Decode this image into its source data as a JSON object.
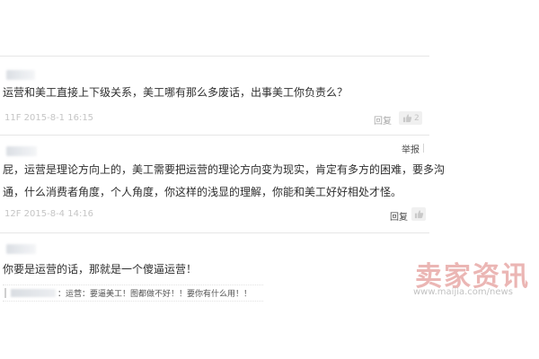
{
  "comments": [
    {
      "text": "运营和美工直接上下级关系，美工哪有那么多废话，出事美工你负责么？",
      "meta": "11F  2015-8-1  16:15",
      "reply_label": "回复",
      "like_count": "2"
    },
    {
      "report_label": "举报",
      "lines": [
        "屁，运营是理论方向上的，美工需要把运营的理论方向变为现实，肯定有多方的困难，要多沟",
        "通，什么消费者角度，个人角度，你这样的浅显的理解，你能和美工好好相处才怪。"
      ],
      "meta": "12F  2015-8-4  14:16",
      "reply_label": "回复"
    },
    {
      "text": "你要是运营的话，那就是一个傻逼运营！",
      "sub_reply": "：运营：要逼美工！图都做不好！！要你有什么用！！"
    }
  ],
  "watermark": {
    "title": "卖家资讯",
    "url": "www.maijia.com/news"
  },
  "colors": {
    "watermark": "#e7a4a2",
    "meta": "#c5c5c5",
    "separator": "#e6e6e6"
  },
  "icons": {
    "like": "thumbs-up-icon"
  }
}
